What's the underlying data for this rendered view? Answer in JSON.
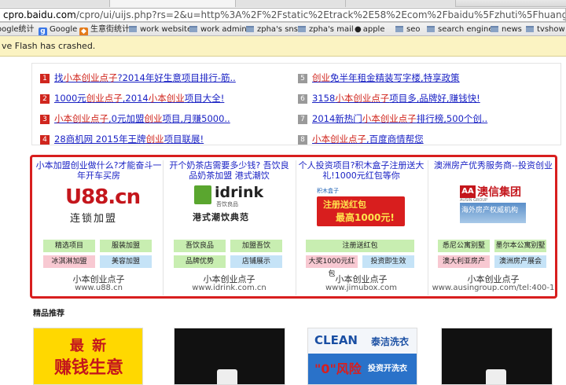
{
  "browser": {
    "url_host": "cpro.baidu.com",
    "url_rest": "/cpro/ui/uijs.php?rs=2&u=http%3A%2F%2Fstatic%2Etrack%2E58%2Ecom%2Fbaidu%5Fzhuti%5Fhuangye%5Flistpage%5Fleft..."
  },
  "bookmarks": [
    {
      "label": "oogle统计",
      "icon": "google-analytics-icon"
    },
    {
      "label": "Google",
      "icon": "google-icon"
    },
    {
      "label": "生意街统计",
      "icon": "stats-icon"
    },
    {
      "label": "work website",
      "icon": "folder-icon"
    },
    {
      "label": "work admin",
      "icon": "folder-icon"
    },
    {
      "label": "zpha's sns",
      "icon": "folder-icon"
    },
    {
      "label": "zpha's mail",
      "icon": "folder-icon"
    },
    {
      "label": "apple",
      "icon": "apple-icon"
    },
    {
      "label": "seo",
      "icon": "folder-icon"
    },
    {
      "label": "search engine",
      "icon": "folder-icon"
    },
    {
      "label": "news",
      "icon": "folder-icon"
    },
    {
      "label": "tvshow",
      "icon": "folder-icon"
    }
  ],
  "infobar": {
    "text": "ve Flash has crashed."
  },
  "text_ads": [
    {
      "num": "1",
      "pre": "找",
      "hl": "小本创业点子",
      "post": "?2014年好生意项目排行-筋..",
      "hl2": ""
    },
    {
      "num": "2",
      "pre": "1000元",
      "hl": "创业点子",
      "post": ",2014",
      "hl2": "小本创业",
      "post2": "项目大全!"
    },
    {
      "num": "3",
      "pre": "",
      "hl": "小本创业点子",
      "post": ",0元加盟",
      "hl2": "创业",
      "post2": "项目,月赚5000.."
    },
    {
      "num": "4",
      "pre": "28商机网 2015年王牌",
      "hl": "创业",
      "post": "项目联展!",
      "hl2": ""
    },
    {
      "num": "5",
      "pre": "",
      "hl": "创业",
      "post": "免半年租金精装写字楼,特享政策",
      "hl2": ""
    },
    {
      "num": "6",
      "pre": "3158",
      "hl": "小本创业点子",
      "post": "项目多,品牌好,赚钱快!",
      "hl2": ""
    },
    {
      "num": "7",
      "pre": "2014新热门",
      "hl": "小本创业点子",
      "post": "排行榜,500个创..",
      "hl2": ""
    },
    {
      "num": "8",
      "pre": "",
      "hl": "小本创业点子",
      "post": ",百度商情帮您",
      "hl2": ""
    }
  ],
  "image_ads": [
    {
      "title": "小本加盟创业做什么?才能奋斗一年开车买房",
      "logo_text": "U88.cn",
      "logo_sub": "连锁加盟",
      "keywords": [
        "精选项目",
        "服装加盟",
        "冰淇淋加盟",
        "美容加盟"
      ],
      "name": "小本创业点子",
      "url": "www.u88.cn"
    },
    {
      "title": "开个奶茶店需要多少钱? 吾饮良品奶茶加盟 港式潮饮",
      "logo_text": "idrink",
      "logo_sub": "港式潮饮典范",
      "logo_small": "吾饮良品",
      "keywords": [
        "吾饮良品",
        "加盟吾饮",
        "品牌优势",
        "店铺展示"
      ],
      "name": "小本创业点子",
      "url": "www.idrink.com.cn"
    },
    {
      "title": "个人投资项目?积木盒子注册送大礼!1000元红包等你",
      "logo_text": "注册送红包",
      "logo_amount": "最高1000元!",
      "logo_small": "积木盒子",
      "keywords": [
        "注册送红包",
        "大奖1000元红包",
        "投资即生效"
      ],
      "name": "小本创业点子",
      "url": "www.jimubox.com"
    },
    {
      "title": "澳洲房产优秀服务商--投资创业",
      "logo_text": "澳信集团",
      "logo_mark": "AA",
      "logo_sub": "海外房产权威机构",
      "logo_small": "AUSIN GROUP",
      "keywords": [
        "悉尼公寓别墅",
        "墨尔本公寓别墅",
        "澳大利亚房产",
        "澳洲房产展会"
      ],
      "name": "小本创业点子",
      "url": "www.ausingroup.com/tel:400-1"
    }
  ],
  "section": {
    "title": "精品推荐"
  },
  "thumbs": [
    {
      "line1": "最 新",
      "line2": "赚钱生意"
    },
    {},
    {
      "brand": "CLEAN",
      "brand_cn": "泰洁洗衣",
      "slogan_big": "\"0\"风险",
      "slogan_small": "投资开洗衣"
    },
    {}
  ],
  "colors": {
    "accent_red": "#d81e1e",
    "link_blue": "#1a22c4",
    "highlight_red": "#d0261e"
  }
}
